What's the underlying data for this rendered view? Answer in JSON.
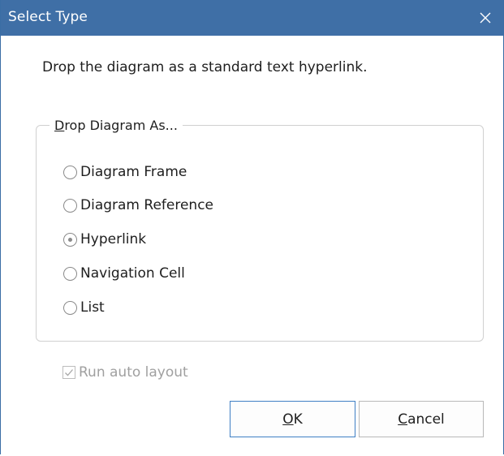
{
  "dialog": {
    "title": "Select Type",
    "description": "Drop the diagram as a standard text hyperlink."
  },
  "group": {
    "legend_mnemonic": "D",
    "legend_rest": "rop Diagram As..."
  },
  "options": [
    {
      "label": "Diagram Frame",
      "selected": false
    },
    {
      "label": "Diagram Reference",
      "selected": false
    },
    {
      "label": "Hyperlink",
      "selected": true
    },
    {
      "label": "Navigation Cell",
      "selected": false
    },
    {
      "label": "List",
      "selected": false
    }
  ],
  "auto_layout": {
    "label": "Run auto layout",
    "checked": true,
    "enabled": false
  },
  "buttons": {
    "ok_mnemonic": "O",
    "ok_rest": "K",
    "cancel_mnemonic": "C",
    "cancel_rest": "ancel"
  },
  "icons": {
    "close": "close-icon",
    "check": "checkmark-icon"
  },
  "colors": {
    "titlebar": "#3f6fa6",
    "ok_border": "#3f7fc4",
    "disabled_text": "#a0a0a0"
  }
}
